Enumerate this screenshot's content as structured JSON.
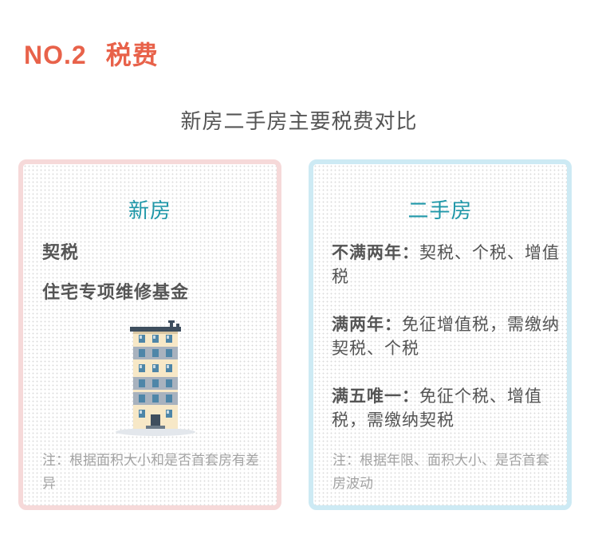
{
  "header": {
    "number": "NO.2",
    "title": "税费"
  },
  "subtitle": "新房二手房主要税费对比",
  "new_house": {
    "title": "新房",
    "items": [
      "契税",
      "住宅专项维修基金"
    ],
    "note": "注：根据面积大小和是否首套房有差异",
    "icon": "apartment-building-icon"
  },
  "second_hand": {
    "title": "二手房",
    "rules": [
      {
        "lead": "不满两年：",
        "text": "契税、个税、增值税"
      },
      {
        "lead": "满两年：",
        "text": "免征增值税，需缴纳契税、个税"
      },
      {
        "lead": "满五唯一：",
        "text": "免征个税、增值税，需缴纳契税"
      }
    ],
    "note": "注：根据年限、面积大小、是否首套房波动"
  },
  "colors": {
    "accent_red": "#e8624a",
    "title_teal": "#1f97a8",
    "new_border": "#f6d9d9",
    "used_border": "#cdeaf4"
  }
}
